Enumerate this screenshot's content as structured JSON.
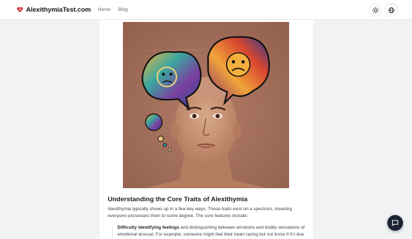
{
  "header": {
    "brand": "AlexithymiaTest.com",
    "nav": [
      "Home",
      "Blog"
    ],
    "theme_icon": "sun-icon",
    "language_icon": "globe-icon"
  },
  "article": {
    "hero_icon": "illustration-head-thought-bubbles",
    "section_title": "Understanding the Core Traits of Alexithymia",
    "intro": "Alexithymia typically shows up in a few key ways. These traits exist on a spectrum, meaning everyone possesses them to some degree. The core features include:",
    "list": [
      {
        "bold": "Difficulty identifying feelings",
        "text": " and distinguishing between emotions and bodily sensations of emotional arousal. For example, someone might feel their heart racing but not know if it's due"
      }
    ]
  },
  "chat_icon": "chat-bubble-icon",
  "colors": {
    "brand_red": "#d6333a",
    "hero_bg": "#a5705c",
    "chat_button": "#1c2333"
  }
}
